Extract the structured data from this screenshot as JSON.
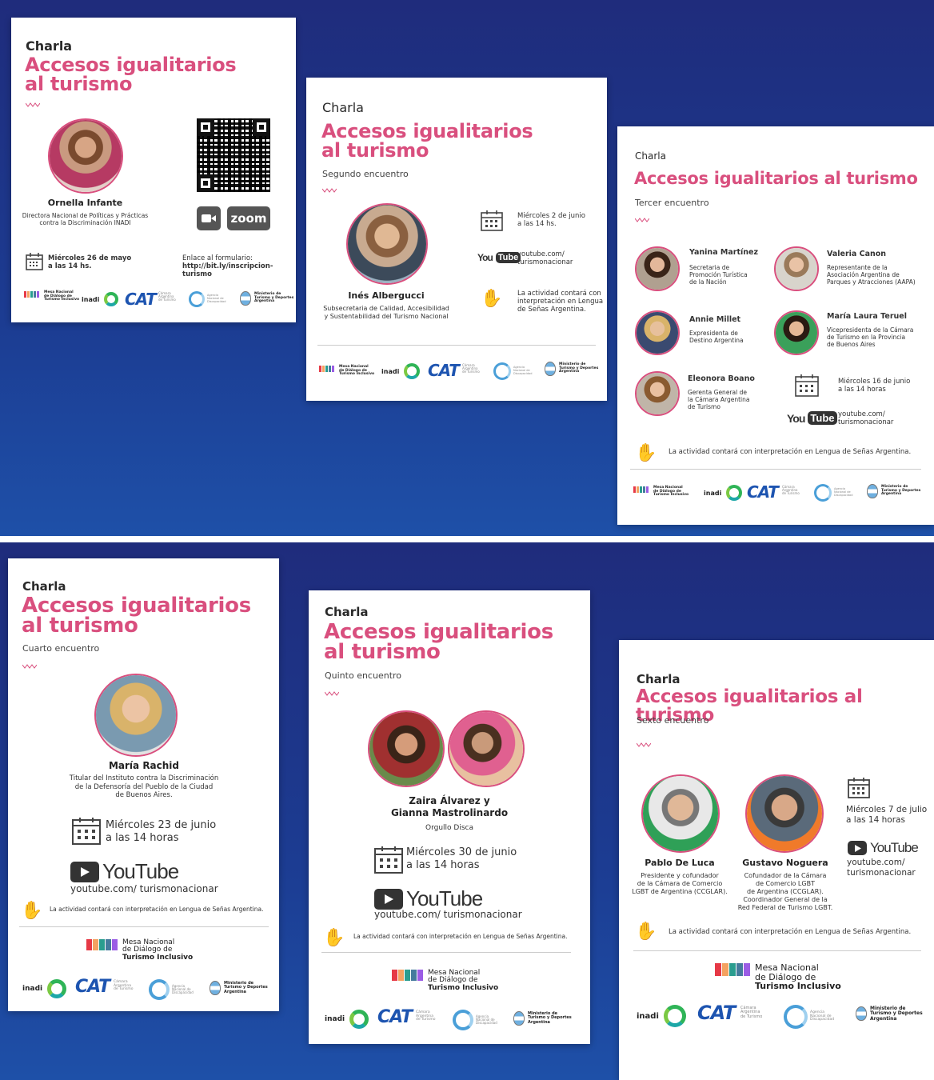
{
  "common": {
    "charla": "Charla",
    "title_line1": "Accesos igualitarios",
    "title_line2": "al turismo",
    "title_full": "Accesos igualitarios al turismo",
    "wave_color": "#d94f7e",
    "accent_color": "#d94f7e",
    "mesa": [
      "Mesa Nacional",
      "de Diálogo de",
      "Turismo Inclusivo"
    ],
    "inadi": "inadi",
    "cat": "CAT",
    "cat_sub": [
      "Cámara",
      "Argentina",
      "de Turismo"
    ],
    "agencia_sub": [
      "Agencia",
      "Nacional de",
      "Discapacidad"
    ],
    "ministerio": [
      "Ministerio de",
      "Turismo y Deportes",
      "Argentina"
    ],
    "youtube_you": "You",
    "youtube_tube": "Tube",
    "youtube_word": "YouTube",
    "lsa": "La actividad contará con interpretación en Lengua de Señas Argentina."
  },
  "card1": {
    "speaker_name": "Ornella Infante",
    "speaker_role": [
      "Directora Nacional de Políticas y Prácticas",
      "contra la Discriminación INADI"
    ],
    "date": [
      "Miércoles 26 de mayo",
      "a las 14 hs."
    ],
    "form_label": "Enlace al formulario:",
    "form_link": "http://bit.ly/inscripcion-turismo",
    "zoom": "zoom"
  },
  "card2": {
    "subtitle": "Segundo encuentro",
    "speaker_name": "Inés Albergucci",
    "speaker_role": [
      "Subsecretaria de Calidad, Accesibilidad",
      "y Sustentabilidad del Turismo Nacional"
    ],
    "date": [
      "Miércoles 2 de junio",
      "a las 14 hs."
    ],
    "yt_link": [
      "youtube.com/",
      "turismonacionar"
    ],
    "lsa": [
      "La actividad contará con",
      "interpretación en Lengua",
      "de Señas Argentina."
    ]
  },
  "card3": {
    "subtitle": "Tercer encuentro",
    "speakers": [
      {
        "name": "Yanina Martínez",
        "role": [
          "Secretaria de",
          "Promoción Turística",
          "de la Nación"
        ]
      },
      {
        "name": "Valeria Canon",
        "role": [
          "Representante de la",
          "Asociación Argentina de",
          "Parques y Atracciones (AAPA)"
        ]
      },
      {
        "name": "Annie Millet",
        "role": [
          "Expresidenta de",
          "Destino Argentina"
        ]
      },
      {
        "name": "María Laura Teruel",
        "role": [
          "Vicepresidenta de la Cámara",
          "de Turismo en la Provincia",
          "de Buenos Aires"
        ]
      },
      {
        "name": "Eleonora Boano",
        "role": [
          "Gerenta General de",
          "la Cámara Argentina",
          "de Turismo"
        ]
      }
    ],
    "date": [
      "Miércoles 16 de junio",
      "a las 14 horas"
    ],
    "yt_link": [
      "youtube.com/",
      "turismonacionar"
    ]
  },
  "card4": {
    "subtitle": "Cuarto encuentro",
    "speaker_name": "María Rachid",
    "speaker_role": [
      "Titular del Instituto contra la Discriminación",
      "de la Defensoría del Pueblo de la Ciudad",
      "de Buenos Aires."
    ],
    "date": [
      "Miércoles 23 de junio",
      "a las 14 horas"
    ],
    "yt_link": "youtube.com/ turismonacionar"
  },
  "card5": {
    "subtitle": "Quinto encuentro",
    "speaker_name": [
      "Zaira Álvarez y",
      "Gianna Mastrolinardo"
    ],
    "speaker_role": "Orgullo Disca",
    "date": [
      "Miércoles 30 de junio",
      "a las 14 horas"
    ],
    "yt_link": "youtube.com/ turismonacionar"
  },
  "card6": {
    "subtitle": "Sexto encuentro",
    "speakers": [
      {
        "name": "Pablo De Luca",
        "role": [
          "Presidente y cofundador",
          "de la Cámara de Comercio",
          "LGBT de Argentina (CCGLAR)."
        ]
      },
      {
        "name": "Gustavo Noguera",
        "role": [
          "Cofundador de la Cámara",
          "de Comercio LGBT",
          "de Argentina (CCGLAR).",
          "Coordinador General de la",
          "Red Federal de Turismo LGBT."
        ]
      }
    ],
    "date": [
      "Miércoles 7 de julio",
      "a las 14 horas"
    ],
    "yt_link": [
      "youtube.com/",
      "turismonacionar"
    ]
  }
}
